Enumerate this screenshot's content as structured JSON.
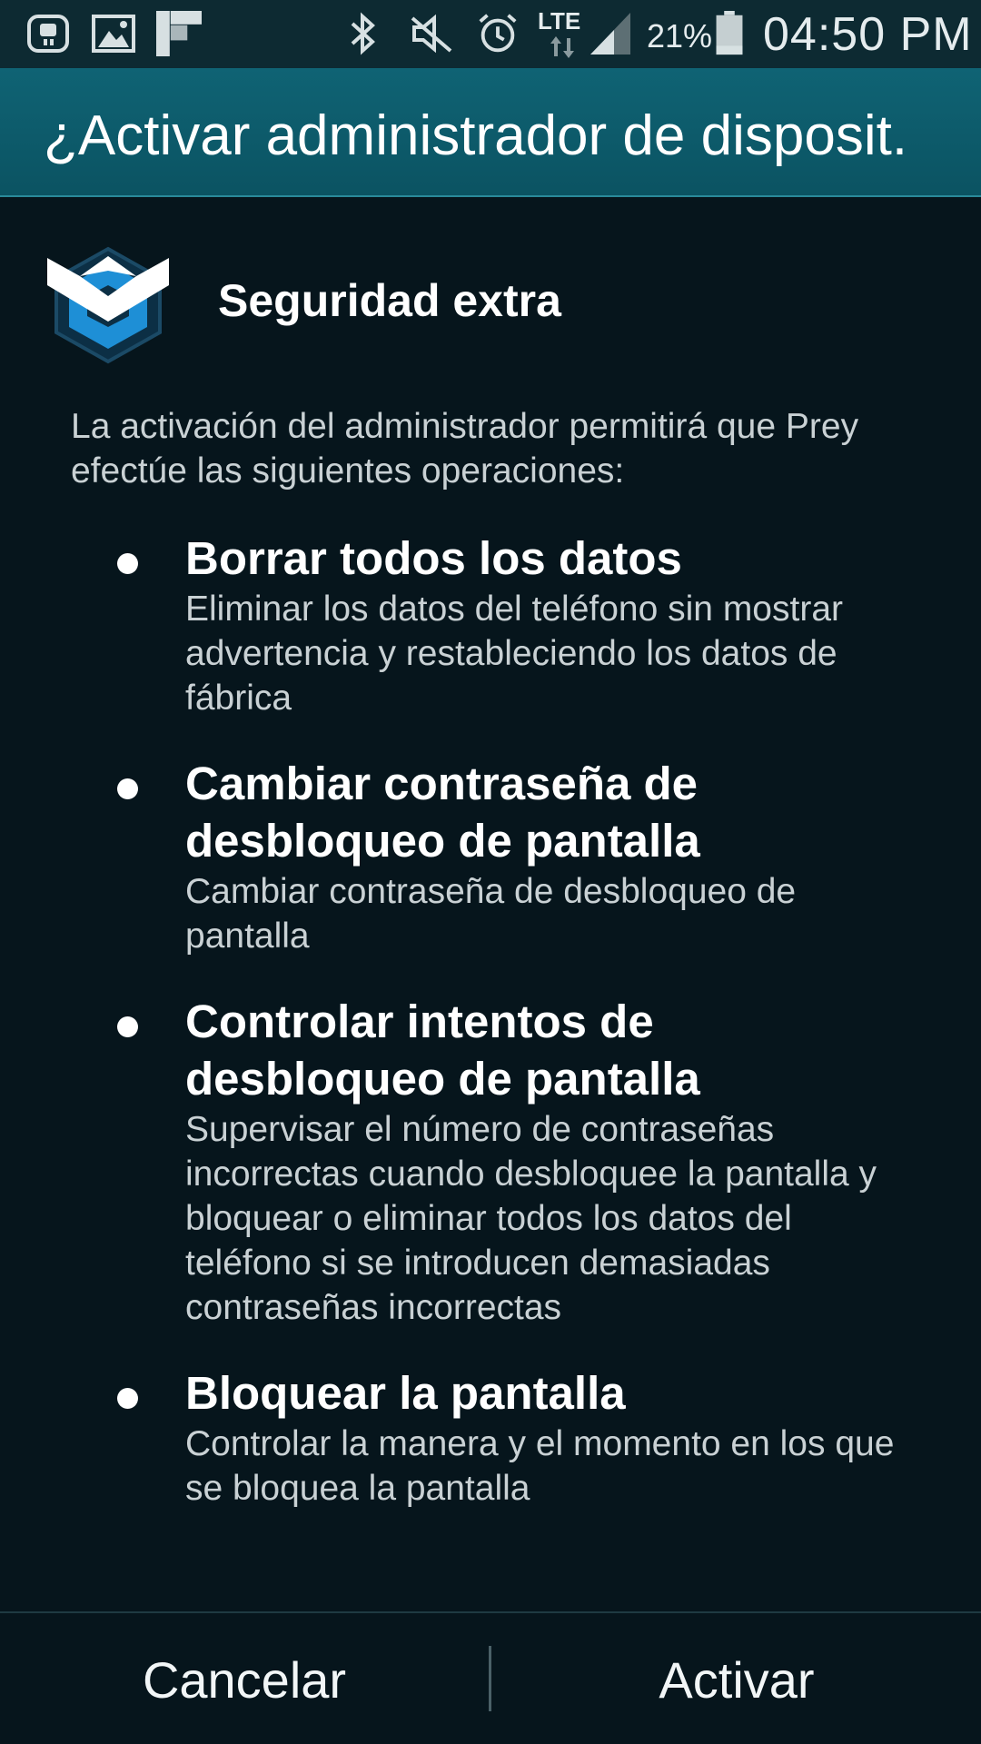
{
  "status_bar": {
    "icons": [
      "cast-icon",
      "gallery-icon",
      "flipboard-icon",
      "bluetooth-icon",
      "mute-icon",
      "alarm-icon",
      "lte-icon",
      "signal-icon",
      "battery-icon"
    ],
    "lte_label": "LTE",
    "battery_percent": "21%",
    "time": "04:50 PM"
  },
  "title_bar": {
    "title": "¿Activar administrador de disposit."
  },
  "app": {
    "name": "Seguridad extra",
    "logo_icon": "prey-shield-logo-icon"
  },
  "intro_text": "La activación del administrador permitirá que Prey efectúe las siguientes operaciones:",
  "permissions": [
    {
      "title": "Borrar todos los datos",
      "description": "Eliminar los datos del teléfono sin mostrar advertencia y restableciendo los datos de fábrica"
    },
    {
      "title": "Cambiar contraseña de desbloqueo de pantalla",
      "description": "Cambiar contraseña de desbloqueo de pantalla"
    },
    {
      "title": "Controlar intentos de desbloqueo de pantalla",
      "description": "Supervisar el número de contraseñas incorrectas cuando desbloquee la pantalla y bloquear o eliminar todos los datos del teléfono si se introducen demasiadas contraseñas incorrectas"
    },
    {
      "title": "Bloquear la pantalla",
      "description": "Controlar la manera y el momento en los que se bloquea la pantalla"
    }
  ],
  "buttons": {
    "cancel_label": "Cancelar",
    "activate_label": "Activar"
  },
  "colors": {
    "background": "#06151c",
    "title_bar": "#0f6374",
    "status_bar": "#0d2a32",
    "logo_blue": "#1e8fd6"
  }
}
